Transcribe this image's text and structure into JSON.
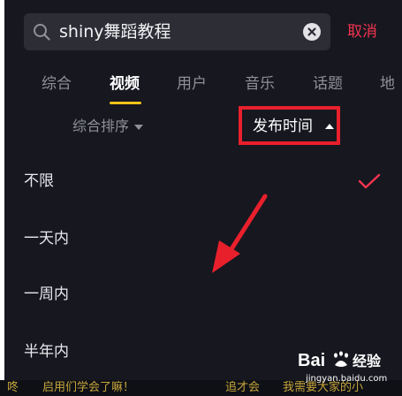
{
  "search": {
    "query": "shiny舞蹈教程",
    "cancel_label": "取消"
  },
  "tabs": [
    {
      "label": "综合",
      "active": false
    },
    {
      "label": "视频",
      "active": true
    },
    {
      "label": "用户",
      "active": false
    },
    {
      "label": "音乐",
      "active": false
    },
    {
      "label": "话题",
      "active": false
    },
    {
      "label": "地",
      "active": false
    }
  ],
  "filters": {
    "sort_label": "综合排序",
    "time_label": "发布时间"
  },
  "time_options": [
    {
      "label": "不限",
      "selected": true
    },
    {
      "label": "一天内",
      "selected": false
    },
    {
      "label": "一周内",
      "selected": false
    },
    {
      "label": "半年内",
      "selected": false
    }
  ],
  "bottom_strip": {
    "parts": [
      "咚",
      "启用们学会了嘛！",
      "追才会",
      "我需要大家的小"
    ]
  },
  "watermark": {
    "brand": "Bai 经验",
    "url": "jingyan.baidu.com"
  },
  "colors": {
    "background": "#16171f",
    "accent_red": "#f2344f",
    "highlight_box": "#e8202c",
    "tab_underline": "#f7c51a"
  },
  "icons": [
    "search-icon",
    "clear-icon",
    "chevron-down-icon",
    "chevron-up-icon",
    "check-icon",
    "annotation-arrow"
  ]
}
